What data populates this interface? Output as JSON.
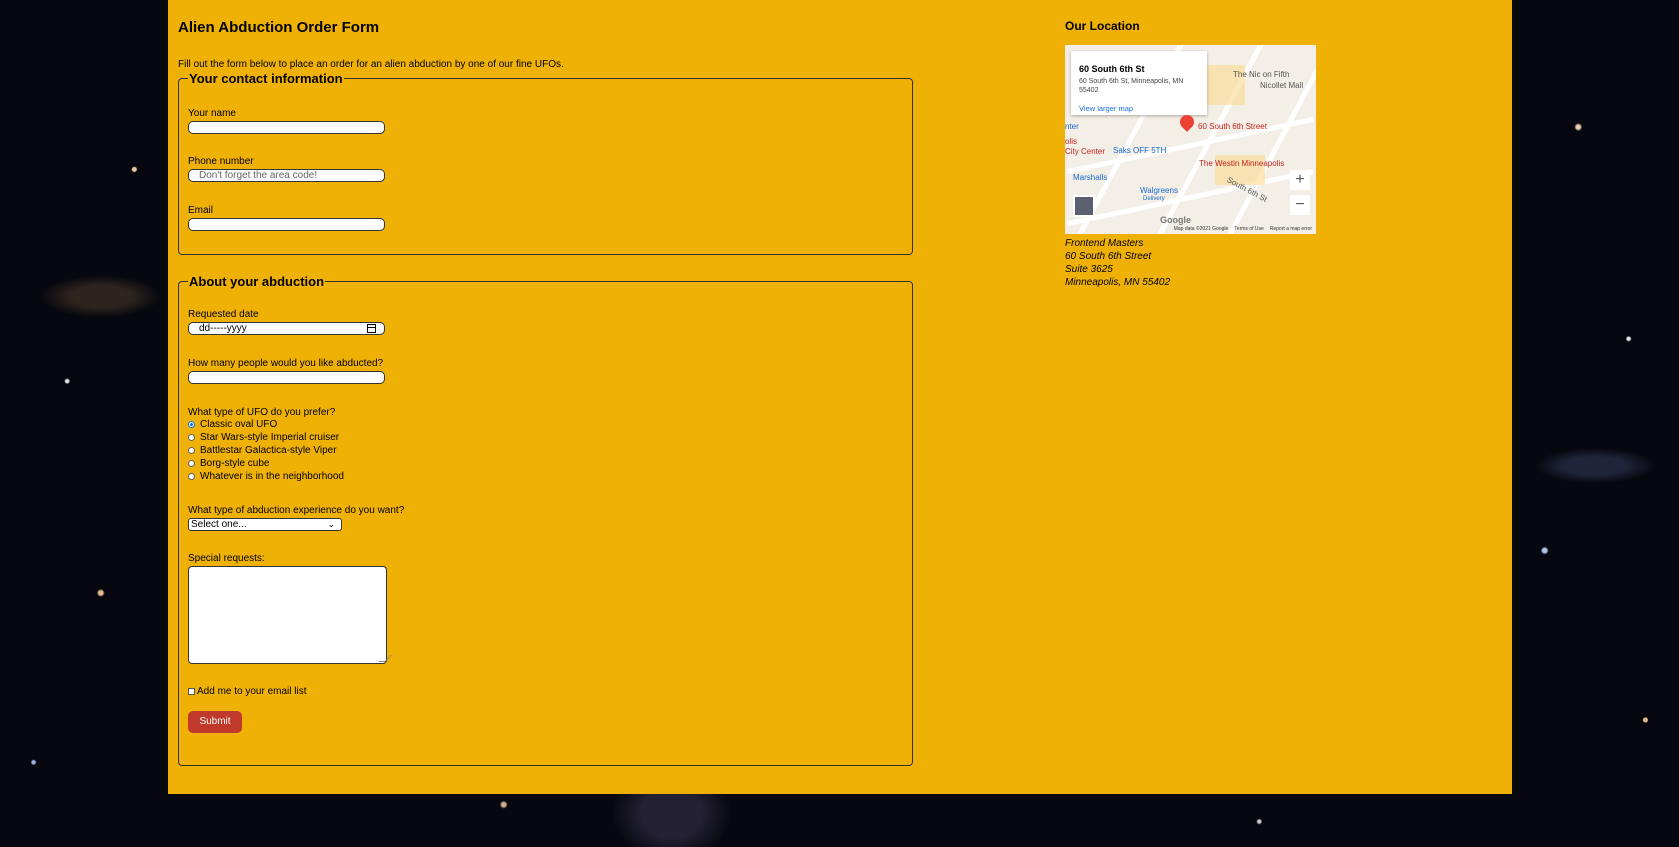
{
  "form": {
    "title": "Alien Abduction Order Form",
    "intro": "Fill out the form below to place an order for an alien abduction by one of our fine UFOs.",
    "contact": {
      "legend": "Your contact information",
      "name_label": "Your name",
      "name_value": "",
      "phone_label": "Phone number",
      "phone_placeholder": "Don't forget the area code!",
      "email_label": "Email",
      "email_value": ""
    },
    "abduction": {
      "legend": "About your abduction",
      "date_label": "Requested date",
      "date_value": "dd-----yyyy",
      "people_label": "How many people would you like abducted?",
      "people_value": "",
      "ufo_label": "What type of UFO do you prefer?",
      "ufo_options": [
        {
          "label": "Classic oval UFO",
          "checked": true
        },
        {
          "label": "Star Wars-style Imperial cruiser",
          "checked": false
        },
        {
          "label": "Battlestar Galactica-style Viper",
          "checked": false
        },
        {
          "label": "Borg-style cube",
          "checked": false
        },
        {
          "label": "Whatever is in the neighborhood",
          "checked": false
        }
      ],
      "experience_label": "What type of abduction experience do you want?",
      "experience_selected": "Select one...",
      "special_label": "Special requests:",
      "email_list_label": "Add me to your email list",
      "submit_label": "Submit"
    }
  },
  "location": {
    "title": "Our Location",
    "map": {
      "card_title": "60 South 6th St",
      "card_address": "60 South 6th St, Minneapolis, MN 55402",
      "card_link": "View larger map",
      "pin_label": "60 South 6th Street",
      "labels": {
        "nic": "The Nic on Fifth",
        "nicollet": "Nicollet Mall",
        "saks": "Saks OFF 5TH",
        "westin": "The Westin Minneapolis",
        "marshalls": "Marshalls",
        "walgreens": "Walgreens",
        "walgreens_sub": "Delivery",
        "center": "nter",
        "city_center_1": "olis",
        "city_center_2": "City Center",
        "south6": "South 6th St"
      },
      "zoom_in": "+",
      "zoom_out": "−",
      "google": "Google",
      "footer": [
        "Map data ©2021 Google",
        "Terms of Use",
        "Report a map error"
      ]
    },
    "address": [
      "Frontend Masters",
      "60 South 6th Street",
      "Suite 3625",
      "Minneapolis, MN 55402"
    ]
  },
  "colors": {
    "page_bg": "#efb105",
    "submit_bg": "#c0392b",
    "map_pin": "#ea4335"
  }
}
